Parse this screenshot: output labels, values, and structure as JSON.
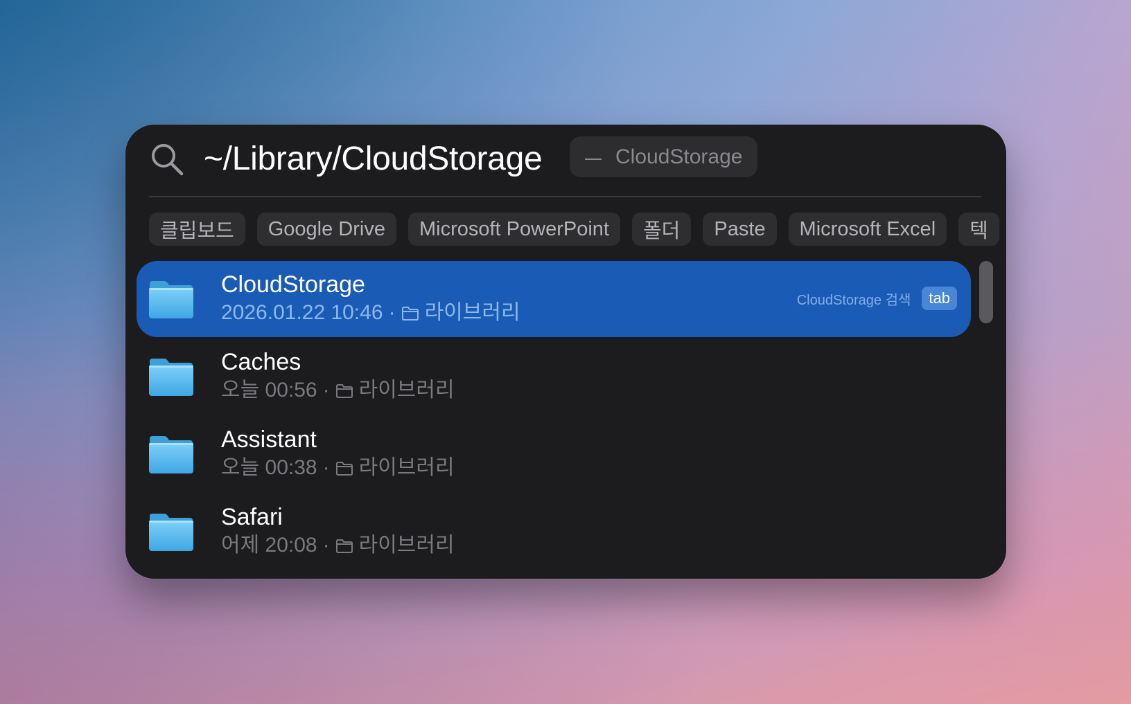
{
  "search": {
    "query": "~/Library/CloudStorage",
    "hint": "CloudStorage"
  },
  "chips": [
    {
      "label": "클립보드"
    },
    {
      "label": "Google Drive"
    },
    {
      "label": "Microsoft PowerPoint"
    },
    {
      "label": "폴더"
    },
    {
      "label": "Paste"
    },
    {
      "label": "Microsoft Excel"
    },
    {
      "label": "텍"
    }
  ],
  "results": [
    {
      "title": "CloudStorage",
      "date": "2026.01.22 10:46",
      "separator": "·",
      "location": "라이브러리",
      "action_label": "CloudStorage 검색",
      "action_key": "tab"
    },
    {
      "title": "Caches",
      "date": "오늘 00:56",
      "separator": "·",
      "location": "라이브러리"
    },
    {
      "title": "Assistant",
      "date": "오늘 00:38",
      "separator": "·",
      "location": "라이브러리"
    },
    {
      "title": "Safari",
      "date": "어제 20:08",
      "separator": "·",
      "location": "라이브러리"
    }
  ],
  "icons": {
    "search": "search-icon",
    "folder": "folder-icon",
    "small_folder": "small-folder-icon"
  },
  "colors": {
    "panel_background": "#1c1c1e",
    "selection": "#1a5bb5",
    "folder": "#5ab8ee",
    "tab_key": "#4a86d6"
  }
}
